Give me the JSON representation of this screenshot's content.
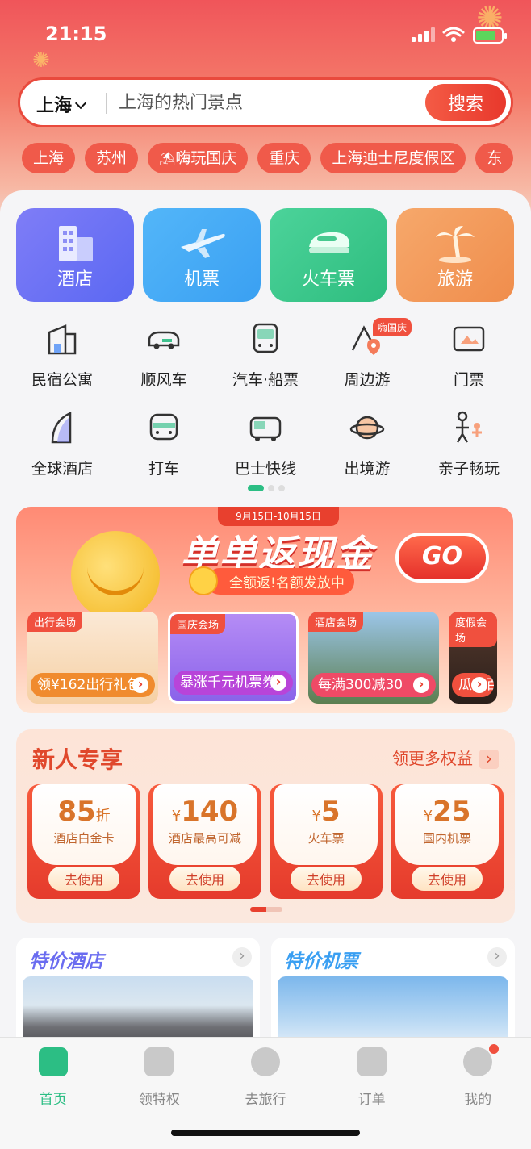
{
  "status_bar": {
    "time": "21:15"
  },
  "search": {
    "city": "上海",
    "placeholder": "上海的热门景点",
    "button": "搜索"
  },
  "chips": [
    "上海",
    "苏州",
    "嗨玩国庆",
    "重庆",
    "上海迪士尼度假区",
    "东"
  ],
  "big_tiles": [
    {
      "label": "酒店",
      "icon": "hotel-building-icon"
    },
    {
      "label": "机票",
      "icon": "airplane-icon"
    },
    {
      "label": "火车票",
      "icon": "train-icon"
    },
    {
      "label": "旅游",
      "icon": "palm-tree-icon"
    }
  ],
  "grid": [
    {
      "label": "民宿公寓",
      "icon": "house-icon"
    },
    {
      "label": "顺风车",
      "icon": "car-icon"
    },
    {
      "label": "汽车·船票",
      "icon": "bus-icon"
    },
    {
      "label": "周边游",
      "icon": "location-pin-icon",
      "tag": "嗨国庆"
    },
    {
      "label": "门票",
      "icon": "ticket-picture-icon"
    },
    {
      "label": "全球酒店",
      "icon": "sail-building-icon"
    },
    {
      "label": "打车",
      "icon": "taxi-icon"
    },
    {
      "label": "巴士快线",
      "icon": "express-bus-icon"
    },
    {
      "label": "出境游",
      "icon": "planet-icon"
    },
    {
      "label": "亲子畅玩",
      "icon": "family-icon"
    }
  ],
  "promo": {
    "date": "9月15日-10月15日",
    "title": "单单返现金",
    "subtitle": "全额返!名额发放中",
    "go": "GO",
    "venues": [
      {
        "tag": "出行会场",
        "text": "领¥162出行礼包"
      },
      {
        "tag": "国庆会场",
        "text": "暴涨千元机票券"
      },
      {
        "tag": "酒店会场",
        "text": "每满300减30"
      },
      {
        "tag": "度假会场",
        "text": "瓜分百"
      }
    ]
  },
  "newbie": {
    "title": "新人专享",
    "more": "领更多权益",
    "coupons": [
      {
        "amount": "85",
        "unit": "折",
        "desc": "酒店白金卡",
        "button": "去使用"
      },
      {
        "prefix": "¥",
        "amount": "140",
        "desc": "酒店最高可减",
        "button": "去使用"
      },
      {
        "prefix": "¥",
        "amount": "5",
        "desc": "火车票",
        "button": "去使用"
      },
      {
        "prefix": "¥",
        "amount": "25",
        "desc": "国内机票",
        "button": "去使用"
      }
    ]
  },
  "cards": [
    {
      "title": "特价酒店"
    },
    {
      "title": "特价机票"
    }
  ],
  "tabbar": [
    {
      "label": "首页",
      "active": true
    },
    {
      "label": "领特权"
    },
    {
      "label": "去旅行"
    },
    {
      "label": "订单"
    },
    {
      "label": "我的",
      "badge": true
    }
  ],
  "colors": {
    "brand_red": "#e8402e",
    "brand_green": "#2cbe84"
  }
}
